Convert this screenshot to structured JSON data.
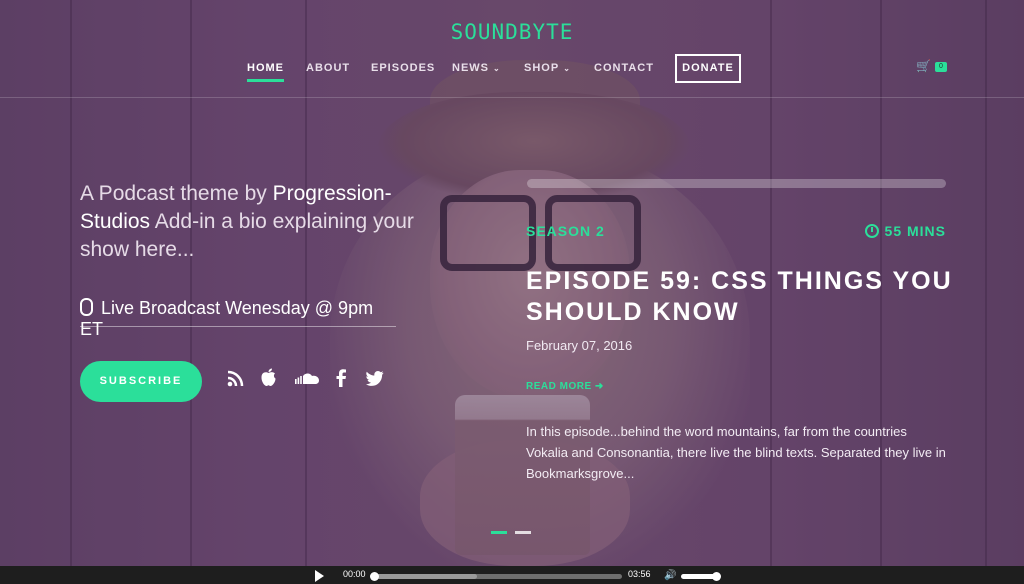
{
  "site": {
    "logo": "SOUNDBYTE"
  },
  "nav": {
    "home": "HOME",
    "about": "ABOUT",
    "episodes": "EPISODES",
    "news": "NEWS",
    "shop": "SHOP",
    "contact": "CONTACT",
    "donate": "DONATE",
    "cart_count": "0"
  },
  "intro": {
    "text_before": "A Podcast theme by ",
    "brand": "Progression-Studios",
    "text_after": " Add-in a bio explaining your show here...",
    "broadcast": "Live Broadcast Wenesday @ 9pm ET",
    "subscribe_label": "SUBSCRIBE",
    "social_icons": [
      "rss-icon",
      "apple-icon",
      "soundcloud-icon",
      "facebook-icon",
      "twitter-icon"
    ]
  },
  "episode": {
    "season": "SEASON 2",
    "duration": "55 MINS",
    "title": "EPISODE 59: CSS THINGS YOU SHOULD KNOW",
    "date": "February 07, 2016",
    "read_more": "READ MORE",
    "description": "In this episode...behind the word mountains, far from the countries Vokalia and Consonantia, there live the blind texts. Separated they live in Bookmarksgrove..."
  },
  "slider": {
    "total": 2,
    "active": 1
  },
  "player": {
    "current_time": "00:00",
    "total_time": "03:56",
    "played_fraction": 0.0,
    "volume_fraction": 1.0
  },
  "colors": {
    "accent": "#2bdf9a",
    "overlay": "#5d4062",
    "player_bar": "#1e1e1e"
  }
}
